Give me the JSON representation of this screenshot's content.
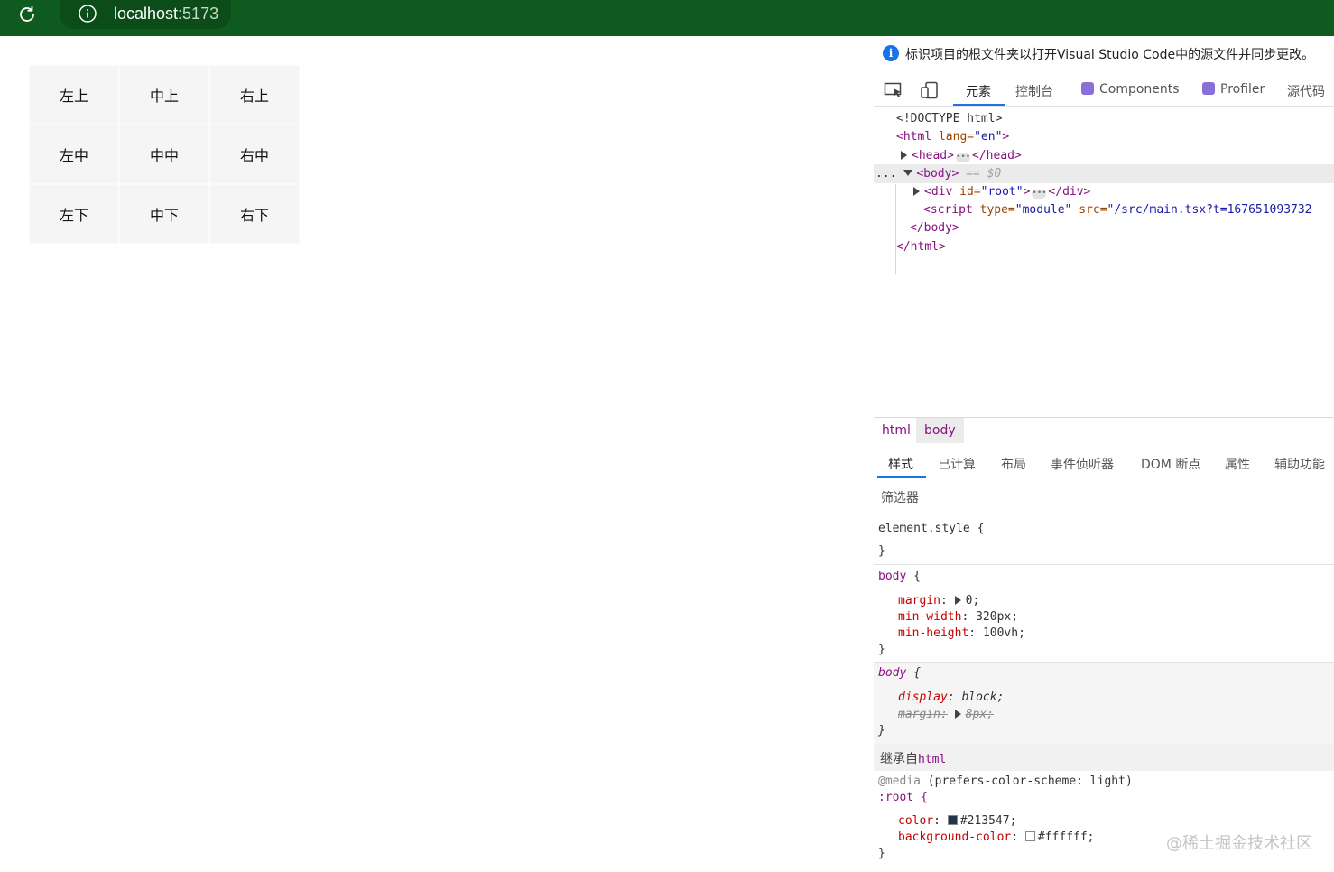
{
  "browser": {
    "url_host": "localhost",
    "url_port": ":5173",
    "icons": [
      "reload-icon",
      "info-icon"
    ],
    "colors": {
      "bar": "#0f5a1f"
    }
  },
  "grid": {
    "cells": [
      "左上",
      "中上",
      "右上",
      "左中",
      "中中",
      "右中",
      "左下",
      "中下",
      "右下"
    ]
  },
  "devtools": {
    "notice": "标识项目的根文件夹以打开Visual Studio Code中的源文件并同步更改。",
    "tabs": {
      "elements": "元素",
      "console": "控制台",
      "components": "Components",
      "profiler": "Profiler",
      "sources": "源代码"
    },
    "dom": {
      "doctype": "<!DOCTYPE html>",
      "html_open": "<html",
      "html_attr_name": " lang=",
      "html_attr_value": "\"en\"",
      "html_close_bracket": ">",
      "head_open": "<head>",
      "head_close": "</head>",
      "body_open": "<body>",
      "body_marker": "== $0",
      "row_dots": "...",
      "div_open": "<div",
      "div_attr_name": " id=",
      "div_attr_value": "\"root\"",
      "div_gt": ">",
      "div_close": "</div>",
      "script_open": "<script",
      "script_type_name": " type=",
      "script_type_value": "\"module\"",
      "script_src_name": " src=",
      "script_src_value": "\"/src/main.tsx?t=167651093732",
      "body_close": "</body>",
      "html_close": "</html>"
    },
    "breadcrumbs": [
      "html",
      "body"
    ],
    "style_tabs": {
      "styles": "样式",
      "computed": "已计算",
      "layout": "布局",
      "listeners": "事件侦听器",
      "dom_breakpoints": "DOM 断点",
      "properties": "属性",
      "accessibility": "辅助功能"
    },
    "filter_placeholder": "筛选器",
    "rules": {
      "element_style": "element.style {",
      "close": "}",
      "body_selector": "body",
      "open": " {",
      "margin_prop": "margin",
      "margin_val": "0;",
      "min_width_prop": "min-width",
      "min_width_val": "320px;",
      "min_height_prop": "min-height",
      "min_height_val": "100vh;",
      "display_prop": "display",
      "display_val": "block;",
      "ua_margin_prop": "margin:",
      "ua_margin_val": "8px;",
      "inherited_label": "继承自",
      "inherited_from": "html",
      "media_at": "@media",
      "media_query": " (prefers-color-scheme: light)",
      "root_selector": ":root {",
      "color_prop": "color",
      "color_val": "#213547;",
      "bg_prop": "background-color",
      "bg_val": "#ffffff;",
      "colon": ": "
    },
    "swatches": {
      "color": "#213547",
      "background": "#ffffff"
    }
  },
  "watermark": "@稀土掘金技术社区"
}
